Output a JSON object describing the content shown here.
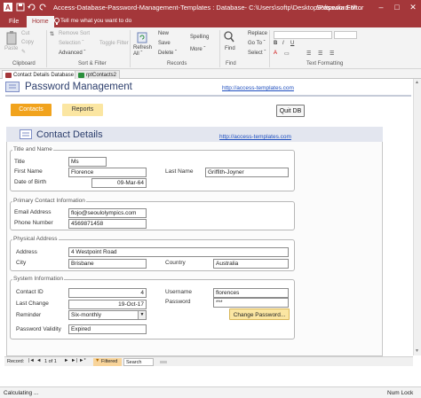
{
  "window": {
    "title": "Access-Database-Password-Management-Templates : Database- C:\\Users\\softp\\Desktop\\Password-M...",
    "brand": "Softpedia Editor",
    "minimize": "–",
    "maximize": "□",
    "close": "✕"
  },
  "ribbon_tabs": {
    "file": "File",
    "home": "Home",
    "tell_me": "Tell me what you want to do"
  },
  "ribbon": {
    "paste": "Paste",
    "cut": "Cut",
    "copy": "Copy",
    "remove_sort": "Remove Sort",
    "selection": "Selection ˇ",
    "advanced": "Advanced ˇ",
    "toggle_filter": "Toggle Filter",
    "refresh_all": "Refresh All ˇ",
    "new": "New",
    "save": "Save",
    "delete": "Delete ˇ",
    "spelling": "Spelling",
    "more": "More ˇ",
    "find": "Find",
    "replace": "Replace",
    "go_to": "Go To ˇ",
    "select": "Select ˇ",
    "groups": {
      "clipboard": "Clipboard",
      "sort_filter": "Sort & Filter",
      "records": "Records",
      "find": "Find",
      "text_formatting": "Text Formatting"
    }
  },
  "doc_tabs": [
    "Contact Details Database",
    "rptContacts2"
  ],
  "form": {
    "title": "Password Management",
    "link": "http://access-templates.com",
    "contacts_btn": "Contacts",
    "reports_btn": "Reports",
    "quit_btn": "Quit DB"
  },
  "subform": {
    "title": "Contact Details",
    "link": "http://access-templates.com",
    "groups": {
      "title_name": "Title and Name",
      "primary_contact": "Primary Contact Information",
      "physical_address": "Physical Address",
      "system_info": "System Information"
    },
    "labels": {
      "title": "Title",
      "first_name": "First Name",
      "last_name": "Last Name",
      "dob": "Date of Birth",
      "email": "Email Address",
      "phone": "Phone Number",
      "address": "Address",
      "city": "City",
      "country": "Country",
      "contact_id": "Contact ID",
      "last_change": "Last Change",
      "reminder": "Reminder",
      "password_validity": "Password Validity",
      "username": "Username",
      "password": "Password"
    },
    "values": {
      "title": "Ms",
      "first_name": "Florence",
      "last_name": "Griffith-Joyner",
      "dob": "09-Mar-64",
      "email": "flojo@seoulolympics.com",
      "phone": "4569871458",
      "address": "4 Westpoint Road",
      "city": "Brisbane",
      "country": "Australia",
      "contact_id": "4",
      "last_change": "19-Oct-17",
      "reminder": "Six-monthly",
      "password_validity": "Expired",
      "username": "florences",
      "password": "***"
    },
    "change_password_btn": "Change Password..."
  },
  "record_nav": {
    "label": "Record:",
    "position": "1 of 1",
    "filtered": "Filtered",
    "search": "Search"
  },
  "status": {
    "left": "Calculating ...",
    "right": "Num Lock"
  },
  "colors": {
    "accent": "#a4373a",
    "button_orange": "#f1a31d",
    "button_yellow": "#fbe6a2"
  }
}
